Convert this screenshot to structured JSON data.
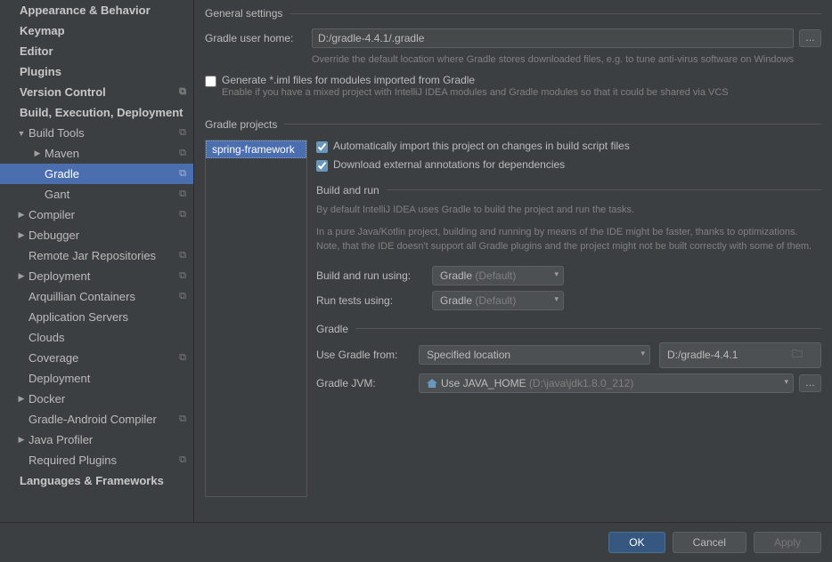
{
  "sidebar": {
    "items": [
      {
        "label": "Appearance & Behavior",
        "bold": true,
        "arrow": "",
        "indent": 0,
        "copy": false
      },
      {
        "label": "Keymap",
        "bold": true,
        "arrow": "",
        "indent": 0,
        "copy": false
      },
      {
        "label": "Editor",
        "bold": true,
        "arrow": "",
        "indent": 0,
        "copy": false
      },
      {
        "label": "Plugins",
        "bold": true,
        "arrow": "",
        "indent": 0,
        "copy": false
      },
      {
        "label": "Version Control",
        "bold": true,
        "arrow": "",
        "indent": 0,
        "copy": true
      },
      {
        "label": "Build, Execution, Deployment",
        "bold": true,
        "arrow": "",
        "indent": 0,
        "copy": false
      },
      {
        "label": "Build Tools",
        "bold": false,
        "arrow": "▼",
        "indent": 1,
        "copy": true
      },
      {
        "label": "Maven",
        "bold": false,
        "arrow": "▶",
        "indent": 2,
        "copy": true
      },
      {
        "label": "Gradle",
        "bold": false,
        "arrow": "",
        "indent": 2,
        "copy": true,
        "selected": true
      },
      {
        "label": "Gant",
        "bold": false,
        "arrow": "",
        "indent": 2,
        "copy": true
      },
      {
        "label": "Compiler",
        "bold": false,
        "arrow": "▶",
        "indent": 1,
        "copy": true
      },
      {
        "label": "Debugger",
        "bold": false,
        "arrow": "▶",
        "indent": 1,
        "copy": false
      },
      {
        "label": "Remote Jar Repositories",
        "bold": false,
        "arrow": "",
        "indent": 1,
        "copy": true
      },
      {
        "label": "Deployment",
        "bold": false,
        "arrow": "▶",
        "indent": 1,
        "copy": true
      },
      {
        "label": "Arquillian Containers",
        "bold": false,
        "arrow": "",
        "indent": 1,
        "copy": true
      },
      {
        "label": "Application Servers",
        "bold": false,
        "arrow": "",
        "indent": 1,
        "copy": false
      },
      {
        "label": "Clouds",
        "bold": false,
        "arrow": "",
        "indent": 1,
        "copy": false
      },
      {
        "label": "Coverage",
        "bold": false,
        "arrow": "",
        "indent": 1,
        "copy": true
      },
      {
        "label": "Deployment",
        "bold": false,
        "arrow": "",
        "indent": 1,
        "copy": false
      },
      {
        "label": "Docker",
        "bold": false,
        "arrow": "▶",
        "indent": 1,
        "copy": false
      },
      {
        "label": "Gradle-Android Compiler",
        "bold": false,
        "arrow": "",
        "indent": 1,
        "copy": true
      },
      {
        "label": "Java Profiler",
        "bold": false,
        "arrow": "▶",
        "indent": 1,
        "copy": false
      },
      {
        "label": "Required Plugins",
        "bold": false,
        "arrow": "",
        "indent": 1,
        "copy": true
      },
      {
        "label": "Languages & Frameworks",
        "bold": true,
        "arrow": "",
        "indent": 0,
        "copy": false
      }
    ]
  },
  "general": {
    "title": "General settings",
    "user_home_label": "Gradle user home:",
    "user_home_value": "D:/gradle-4.4.1/.gradle",
    "user_home_hint": "Override the default location where Gradle stores downloaded files, e.g. to tune anti-virus software on Windows",
    "generate_iml_label": "Generate *.iml files for modules imported from Gradle",
    "generate_iml_hint": "Enable if you have a mixed project with IntelliJ IDEA modules and Gradle modules so that it could be shared via VCS"
  },
  "projects": {
    "title": "Gradle projects",
    "selected": "spring-framework",
    "auto_import_label": "Automatically import this project on changes in build script files",
    "download_annotations_label": "Download external annotations for dependencies",
    "build_run_title": "Build and run",
    "build_run_desc1": "By default IntelliJ IDEA uses Gradle to build the project and run the tasks.",
    "build_run_desc2": "In a pure Java/Kotlin project, building and running by means of the IDE might be faster, thanks to optimizations. Note, that the IDE doesn't support all Gradle plugins and the project might not be built correctly with some of them.",
    "build_using_label": "Build and run using:",
    "build_using_value": "Gradle",
    "build_using_suffix": "(Default)",
    "tests_using_label": "Run tests using:",
    "tests_using_value": "Gradle",
    "tests_using_suffix": "(Default)",
    "gradle_title": "Gradle",
    "gradle_from_label": "Use Gradle from:",
    "gradle_from_value": "Specified location",
    "gradle_path": "D:/gradle-4.4.1",
    "jvm_label": "Gradle JVM:",
    "jvm_value": "Use JAVA_HOME",
    "jvm_path": "(D:\\java\\jdk1.8.0_212)"
  },
  "buttons": {
    "ok": "OK",
    "cancel": "Cancel",
    "apply": "Apply"
  }
}
